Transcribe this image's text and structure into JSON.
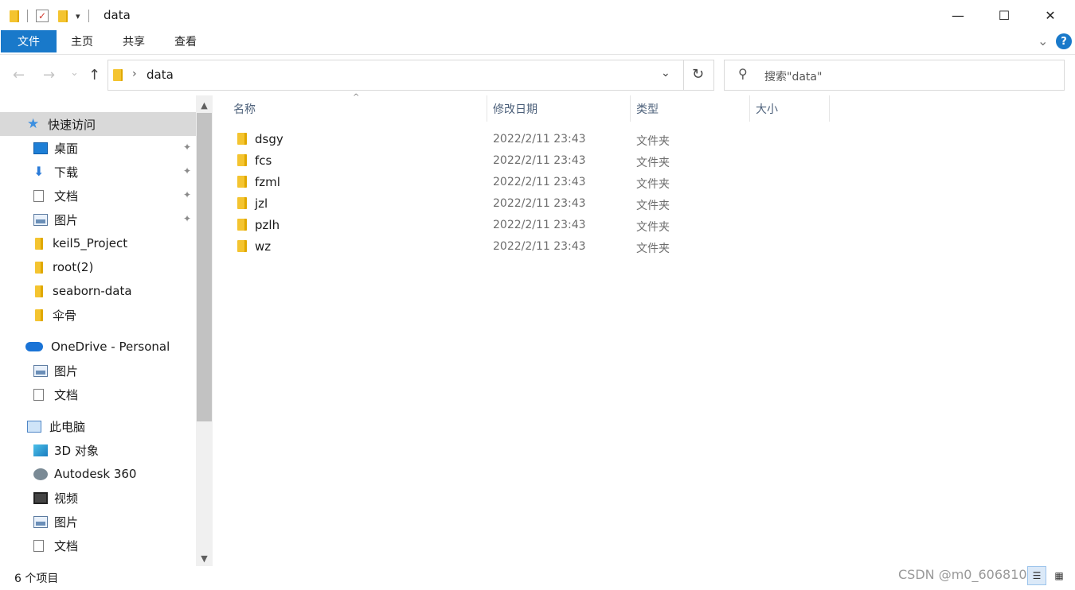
{
  "window": {
    "title": "data",
    "minimize_glyph": "—",
    "maximize_glyph": "☐",
    "close_glyph": "✕"
  },
  "quick_access_toolbar": {
    "dropdown_glyph": "▾"
  },
  "ribbon": {
    "tabs": [
      "文件",
      "主页",
      "共享",
      "查看"
    ],
    "collapse_glyph": "⌄",
    "help_glyph": "?"
  },
  "address_bar": {
    "back_glyph": "←",
    "forward_glyph": "→",
    "recent_glyph": "⌄",
    "up_glyph": "↑",
    "separator_glyph": "›",
    "path": "data",
    "dropdown_glyph": "⌄",
    "refresh_glyph": "↻"
  },
  "search": {
    "icon_glyph": "⚲",
    "placeholder": "搜索\"data\""
  },
  "nav_pane": {
    "items": [
      {
        "label": "快速访问",
        "icon": "star-icon",
        "active": true
      },
      {
        "label": "桌面",
        "icon": "desktop-icon",
        "pinned": true
      },
      {
        "label": "下载",
        "icon": "download-icon",
        "pinned": true
      },
      {
        "label": "文档",
        "icon": "document-icon",
        "pinned": true
      },
      {
        "label": "图片",
        "icon": "picture-icon",
        "pinned": true
      },
      {
        "label": "keil5_Project",
        "icon": "folder-icon"
      },
      {
        "label": "root(2)",
        "icon": "folder-icon"
      },
      {
        "label": "seaborn-data",
        "icon": "folder-icon"
      },
      {
        "label": "伞骨",
        "icon": "folder-icon"
      },
      {
        "label": "OneDrive - Personal",
        "icon": "cloud-icon"
      },
      {
        "label": "图片",
        "icon": "picture-icon"
      },
      {
        "label": "文档",
        "icon": "document-icon"
      },
      {
        "label": "此电脑",
        "icon": "computer-icon"
      },
      {
        "label": "3D 对象",
        "icon": "3d-objects-icon"
      },
      {
        "label": "Autodesk 360",
        "icon": "autodesk-icon"
      },
      {
        "label": "视频",
        "icon": "video-icon"
      },
      {
        "label": "图片",
        "icon": "picture-icon"
      },
      {
        "label": "文档",
        "icon": "document-icon"
      }
    ],
    "pin_glyph": "📌",
    "scroll_up_glyph": "▲",
    "scroll_down_glyph": "▼"
  },
  "file_list": {
    "columns": [
      "名称",
      "修改日期",
      "类型",
      "大小"
    ],
    "sort_glyph": "^",
    "rows": [
      {
        "name": "dsgy",
        "date": "2022/2/11 23:43",
        "type": "文件夹",
        "size": ""
      },
      {
        "name": "fcs",
        "date": "2022/2/11 23:43",
        "type": "文件夹",
        "size": ""
      },
      {
        "name": "fzml",
        "date": "2022/2/11 23:43",
        "type": "文件夹",
        "size": ""
      },
      {
        "name": "jzl",
        "date": "2022/2/11 23:43",
        "type": "文件夹",
        "size": ""
      },
      {
        "name": "pzlh",
        "date": "2022/2/11 23:43",
        "type": "文件夹",
        "size": ""
      },
      {
        "name": "wz",
        "date": "2022/2/11 23:43",
        "type": "文件夹",
        "size": ""
      }
    ]
  },
  "status_bar": {
    "item_count": "6 个项目",
    "watermark": "CSDN @m0_60681041",
    "details_view_glyph": "☰",
    "tiles_view_glyph": "▦"
  }
}
